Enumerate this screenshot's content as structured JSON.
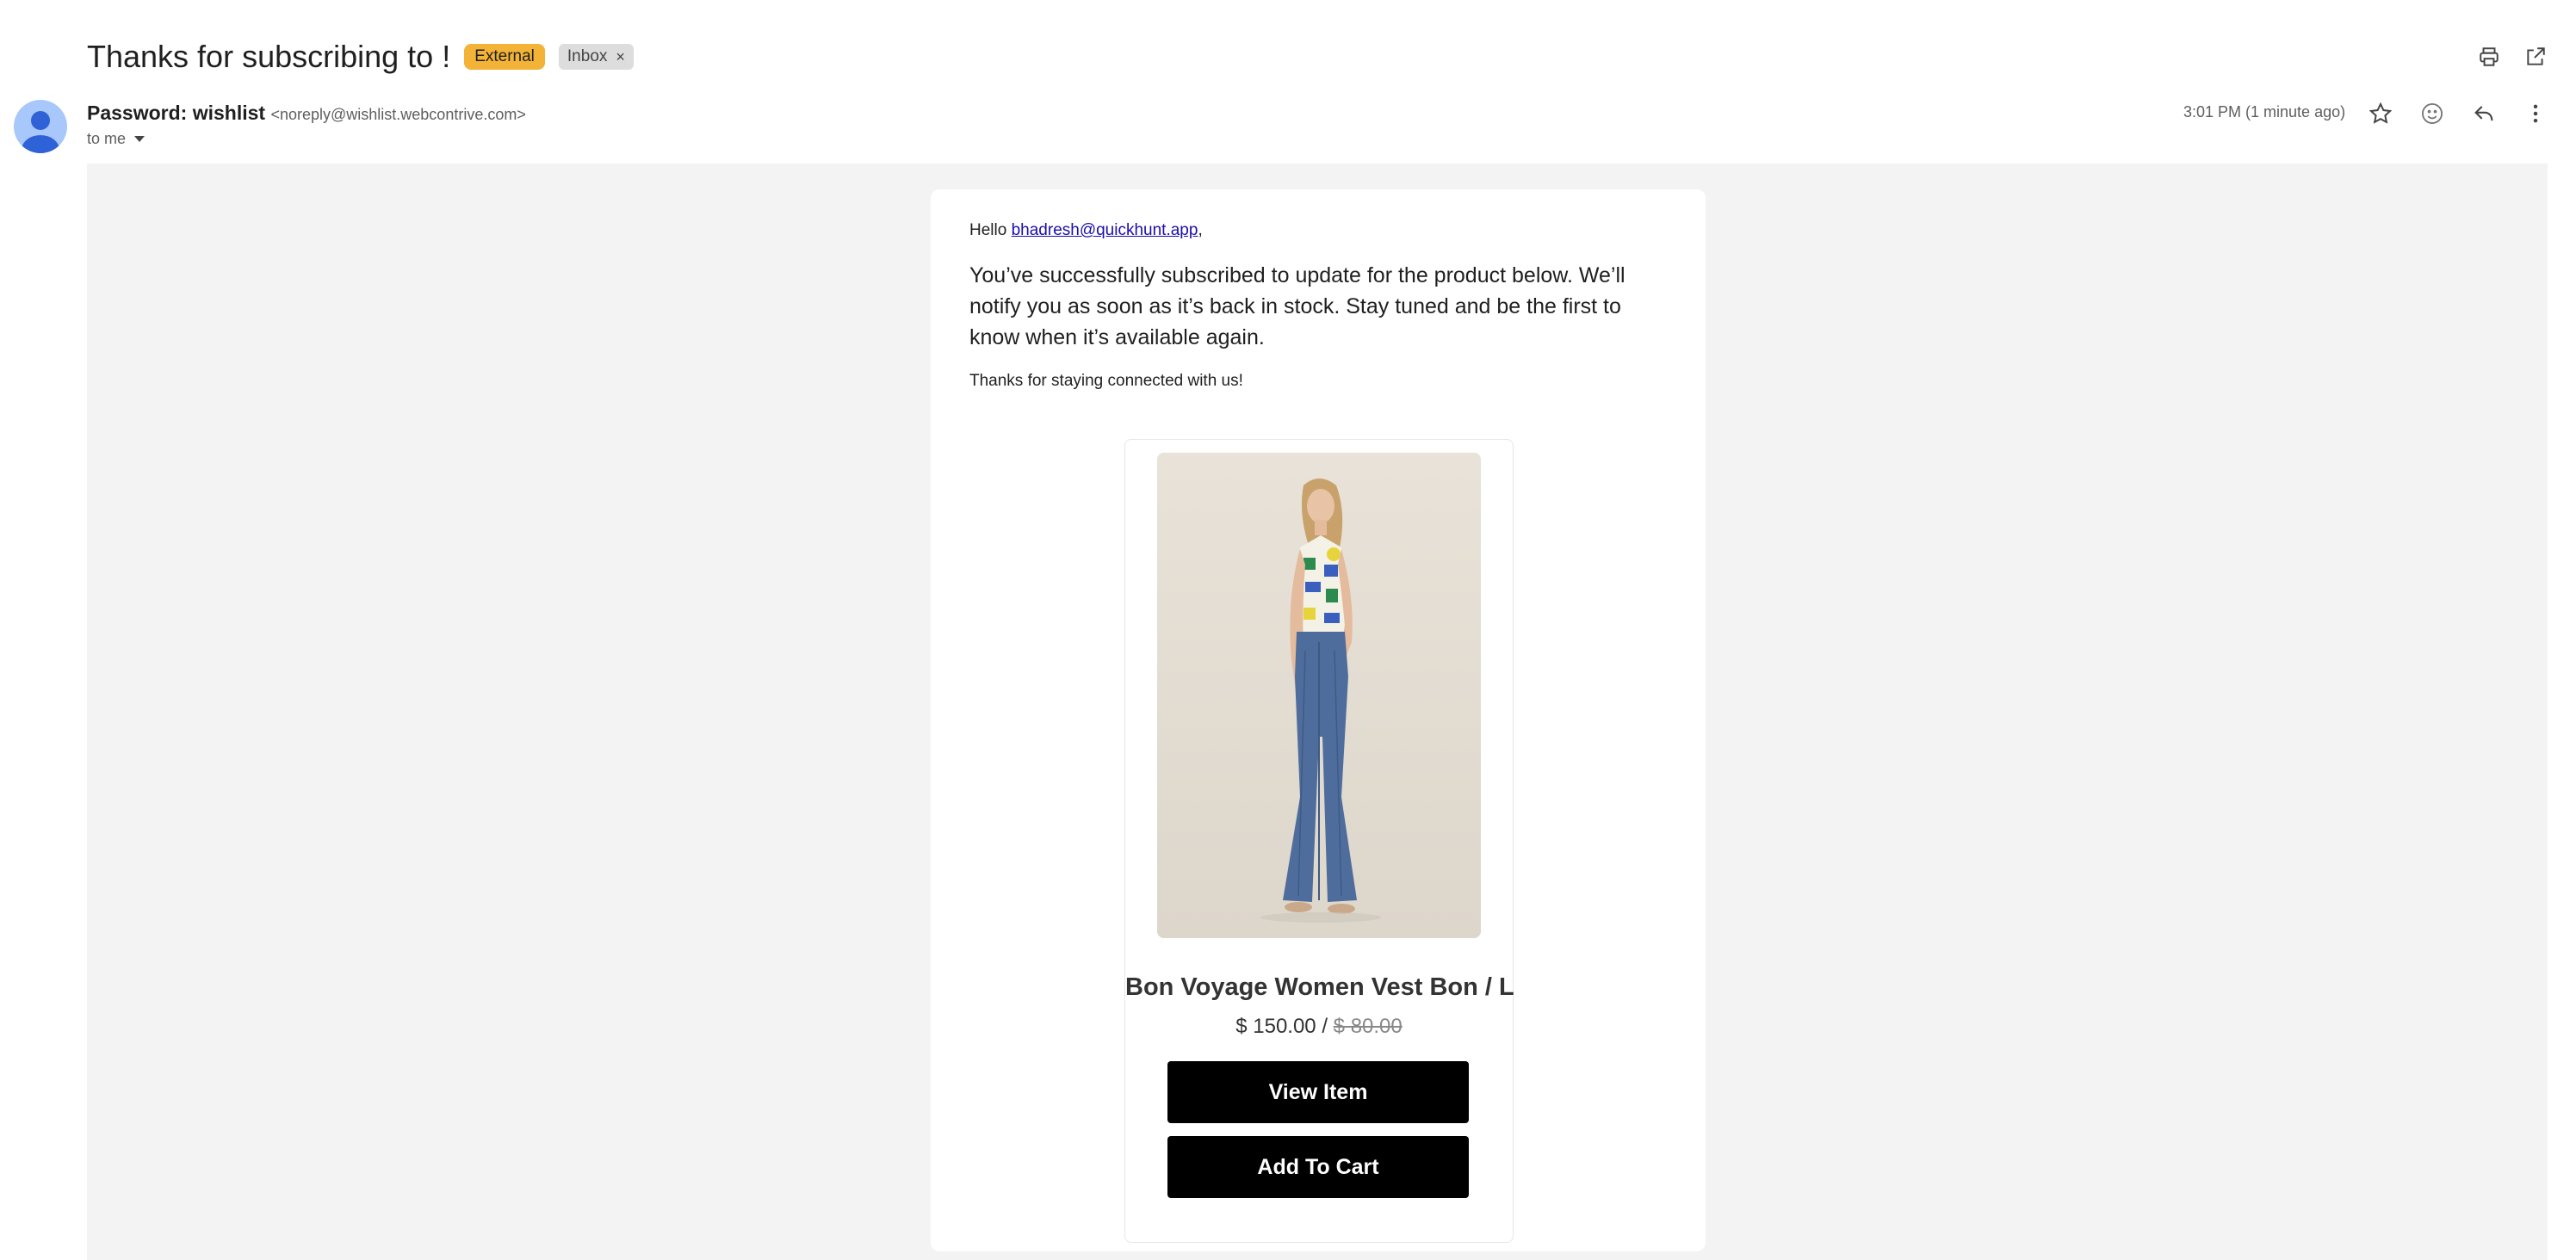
{
  "subject": "Thanks for subscribing to !",
  "labels": {
    "external": "External",
    "inbox": "Inbox",
    "inbox_remove": "×"
  },
  "sender": {
    "name": "Password: wishlist",
    "email": "<noreply@wishlist.webcontrive.com>",
    "to": "to me"
  },
  "time": "3:01 PM (1 minute ago)",
  "icons": {
    "print": "print-icon",
    "open_new_window": "open-in-new-window-icon",
    "star": "star-icon",
    "emoji": "emoji-icon",
    "reply": "reply-icon",
    "more": "more-vert-icon"
  },
  "email": {
    "greeting": "Hello",
    "recipient": "bhadresh@quickhunt.app",
    "greeting_suffix": ",",
    "message": "You’ve successfully subscribed to update for the product below. We’ll notify you as soon as it’s back in stock. Stay tuned and be the first to know when it’s available again.",
    "thanks": "Thanks for staying connected with us!",
    "product": {
      "name": "Bon Voyage Women Vest Bon / L",
      "price": "$ 150.00",
      "price_sep": " / ",
      "compare_price": "$ 80.00",
      "view_label": "View Item",
      "cart_label": "Add To Cart"
    }
  },
  "colors": {
    "external_label": "#f2b336",
    "inbox_label": "#dddddd",
    "link": "#1a0dab",
    "button": "#000000",
    "canvas": "#f3f3f3",
    "avatar": "#a8c7fa"
  }
}
